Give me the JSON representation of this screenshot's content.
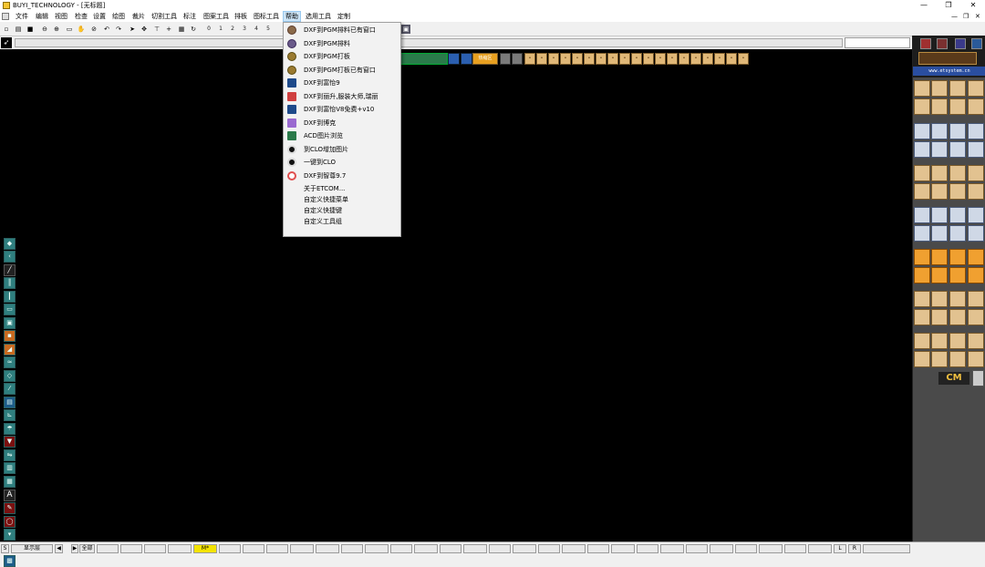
{
  "window": {
    "title": "BUYI_TECHNOLOGY - [无标题]",
    "minimize": "—",
    "restore": "❐",
    "close": "✕"
  },
  "menubar": {
    "items": [
      "文件",
      "编辑",
      "视图",
      "检查",
      "设置",
      "绘图",
      "裁片",
      "切割工具",
      "标注",
      "图案工具",
      "排板",
      "图标工具",
      "帮助",
      "选用工具",
      "定制"
    ],
    "active": "帮助",
    "mdi_minimize": "—",
    "mdi_restore": "❐",
    "mdi_close": "✕"
  },
  "toolbar": {
    "icons": [
      "new-icon",
      "open-icon",
      "save-icon",
      "zoom-out-icon",
      "zoom-in-icon",
      "fit-window-icon",
      "pan-hand-icon",
      "zoom-window-icon",
      "undo-icon",
      "redo-icon",
      "select-icon",
      "move-icon",
      "vertical-line-icon",
      "crosshair-icon",
      "grid-icon",
      "rotate-icon"
    ],
    "glyphs": [
      "▫",
      "▤",
      "■",
      "⊖",
      "⊕",
      "▭",
      "✋",
      "⊘",
      "↶",
      "↷",
      "➤",
      "✥",
      "⊤",
      "+",
      "▦",
      "↻"
    ],
    "numbers": [
      "0",
      "1",
      "2",
      "3",
      "4",
      "5"
    ]
  },
  "help_menu": {
    "items": [
      {
        "label": "DXF到PGM排料已有窗口",
        "icon": "pgm-globe-icon",
        "color": "#8a6a4a"
      },
      {
        "label": "DXF到PGM排料",
        "icon": "pgm-globe-icon",
        "color": "#6a5a8a"
      },
      {
        "label": "DXF到PGM打板",
        "icon": "pgm-globe-icon",
        "color": "#9a7a30"
      },
      {
        "label": "DXF到PGM打板已有窗口",
        "icon": "pgm-globe-icon",
        "color": "#9a7a30"
      },
      {
        "label": "DXF到富怡9",
        "icon": "richpeace-icon",
        "color": "#1e4a8a"
      },
      {
        "label": "DXF到丽升,服装大师,瑞丽",
        "icon": "lisheng-icon",
        "color": "#d04040"
      },
      {
        "label": "DXF到富怡V8免费+v10",
        "icon": "richpeace-icon",
        "color": "#1e4a8a"
      },
      {
        "label": "DXF到博克",
        "icon": "boke-icon",
        "color": "#9a6ad0"
      },
      {
        "label": "ACD图片浏览",
        "icon": "image-viewer-icon",
        "color": "#2a7a4a"
      },
      {
        "label": "到CLO增加图片",
        "icon": "clo-icon",
        "color": "#111111"
      },
      {
        "label": "一键到CLO",
        "icon": "clo-icon",
        "color": "#111111"
      },
      {
        "label": "DXF到智尊9.7",
        "icon": "zhizun-icon",
        "color": "#e05050"
      },
      {
        "label": "关于ETCOM...",
        "icon": "",
        "color": ""
      },
      {
        "label": "自定义快捷菜单",
        "icon": "",
        "color": ""
      },
      {
        "label": "自定义快捷键",
        "icon": "",
        "color": ""
      },
      {
        "label": "自定义工具组",
        "icon": "",
        "color": ""
      }
    ]
  },
  "strip": {
    "label": "热缩区"
  },
  "right_panel": {
    "url": "www.etsystem.cn",
    "logo": "CM"
  },
  "left_tools": {
    "icons": [
      "point-icon",
      "curve-icon",
      "line-icon",
      "parallel-icon",
      "vertical-icon",
      "rectangle-icon",
      "square-icon",
      "seam-icon",
      "dart-icon",
      "pleat-icon",
      "notch-icon",
      "measure-icon",
      "block-icon",
      "fold-icon",
      "umbrella-icon",
      "warning-icon",
      "mirror-icon",
      "size-icon",
      "stack-icon",
      "text-icon",
      "pen-icon",
      "circle-icon",
      "drill-icon",
      "cut-icon",
      "save-block-icon"
    ],
    "glyphs": [
      "◆",
      "‹",
      "╱",
      "║",
      "┃",
      "▭",
      "▣",
      "▪",
      "◢",
      "≈",
      "◇",
      "⁄",
      "▤",
      "⊾",
      "☂",
      "▼",
      "⇋",
      "▥",
      "▦",
      "A",
      "✎",
      "◯",
      "▾",
      "✂",
      "▩"
    ]
  },
  "statusbar": {
    "layer_label": "显示层",
    "prev": "◀",
    "next": "▶",
    "all_label": "全部",
    "s_label": "S",
    "l_label": "L",
    "r_label": "R",
    "yellow_label": "M*"
  },
  "colors": {
    "canvas": "#000000",
    "menu_highlight": "#cce4f7",
    "panel_tan": "#e2c290"
  }
}
